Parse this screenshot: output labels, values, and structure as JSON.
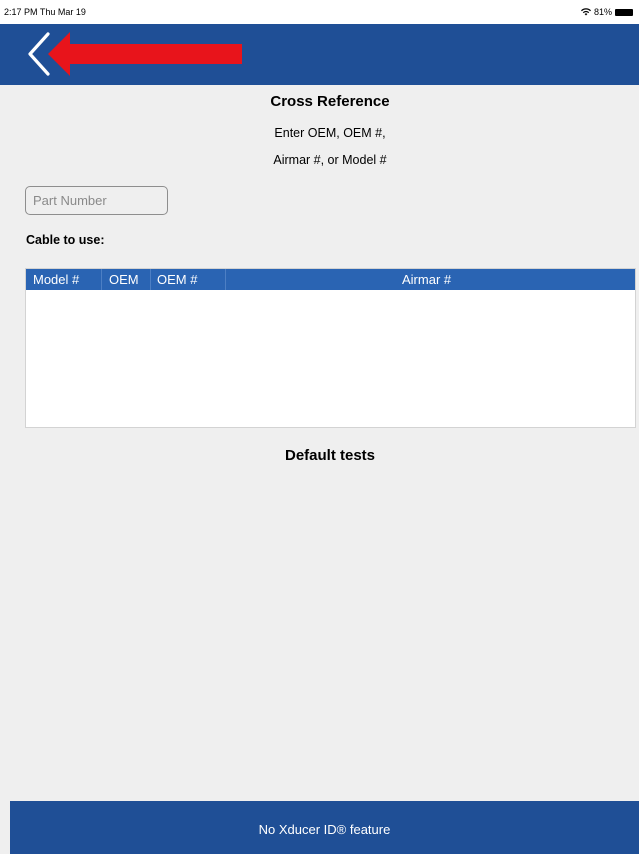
{
  "status_bar": {
    "time": "2:17 PM  Thu Mar 19",
    "battery": "81%"
  },
  "nav": {
    "back_icon": "chevron-left-icon",
    "annotation_arrow": "red-arrow-icon",
    "annotation_color": "#e8141b",
    "bar_color": "#1f4f96"
  },
  "main": {
    "title": "Cross Reference",
    "instruction_line1": "Enter OEM, OEM #,",
    "instruction_line2": "Airmar #, or Model #",
    "part_number_placeholder": "Part Number",
    "part_number_value": "",
    "cable_label": "Cable to use:",
    "table": {
      "columns": [
        "Model #",
        "OEM",
        "OEM #",
        "Airmar #"
      ],
      "rows": []
    },
    "default_tests_heading": "Default tests"
  },
  "footer": {
    "text": "No Xducer ID® feature"
  }
}
